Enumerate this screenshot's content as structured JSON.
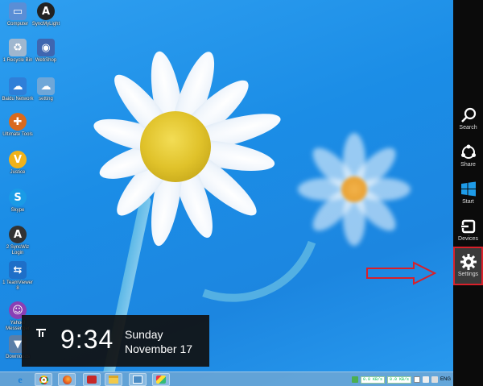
{
  "desktop_icons": [
    {
      "label": "Computer",
      "icon": "computer-icon",
      "color": "#5a8ed6"
    },
    {
      "label": "SyncMyLight",
      "icon": "sync-icon",
      "color": "#222222"
    },
    {
      "label": "1 Recycle Bin",
      "icon": "recycle-bin-icon",
      "color": "#9fb7cf"
    },
    {
      "label": "WebShop",
      "icon": "web-icon",
      "color": "#3f66b0"
    },
    {
      "label": "Baidu Network",
      "icon": "network-icon",
      "color": "#2f7fd8"
    },
    {
      "label": "setting",
      "icon": "setting-shortcut-icon",
      "color": "#6fa7d8"
    },
    {
      "label": "Ultimate Tools",
      "icon": "tools-icon",
      "color": "#d96a1e"
    },
    {
      "label": "Justice",
      "icon": "justice-icon",
      "color": "#f0b21a"
    },
    {
      "label": "Skype",
      "icon": "skype-icon",
      "color": "#1a9be6"
    },
    {
      "label": "2 SyncWiz Login",
      "icon": "login-icon",
      "color": "#333333"
    },
    {
      "label": "1 TeamViewer 8",
      "icon": "teamviewer-icon",
      "color": "#1e6fc8"
    },
    {
      "label": "Yahoo! Messenger",
      "icon": "messenger-icon",
      "color": "#8a3fb4"
    },
    {
      "label": "Downloads",
      "icon": "downloads-icon",
      "color": "#5b7fa8"
    }
  ],
  "charms": [
    {
      "label": "Search",
      "icon": "search-icon"
    },
    {
      "label": "Share",
      "icon": "share-icon"
    },
    {
      "label": "Start",
      "icon": "windows-start-icon"
    },
    {
      "label": "Devices",
      "icon": "devices-icon"
    },
    {
      "label": "Settings",
      "icon": "gear-icon",
      "active": true
    }
  ],
  "clock": {
    "time": "9:34",
    "day": "Sunday",
    "date": "November 17"
  },
  "taskbar": {
    "apps": [
      "internet-explorer-icon",
      "chrome-icon",
      "firefox-icon",
      "app-red-icon",
      "file-explorer-icon",
      "media-icon",
      "paint-icon"
    ],
    "tray": {
      "upload_speed": "0.0 KB/s",
      "download_speed": "0.0 KB/s",
      "language": "ENG"
    }
  },
  "colors": {
    "charms_bg": "#0b0b0b",
    "highlight": "#d8202a",
    "wallpaper": "#1c8ae4"
  }
}
